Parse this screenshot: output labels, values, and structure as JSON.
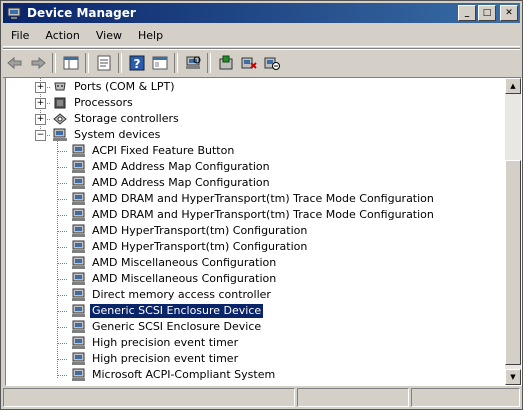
{
  "window": {
    "title": "Device Manager",
    "buttons": {
      "minimize": "_",
      "maximize": "□",
      "close": "✕"
    }
  },
  "menu": [
    "File",
    "Action",
    "View",
    "Help"
  ],
  "toolbar": {
    "icons": [
      "back-arrow-icon",
      "forward-arrow-icon",
      "show-hide-console-tree-icon",
      "properties-icon",
      "help-icon",
      "console-view-icon",
      "scan-hardware-icon",
      "update-driver-icon",
      "uninstall-icon",
      "disable-icon"
    ]
  },
  "tree": {
    "partial_top": "",
    "categories": [
      {
        "label": "Ports (COM & LPT)",
        "expanded": false
      },
      {
        "label": "Processors",
        "expanded": false
      },
      {
        "label": "Storage controllers",
        "expanded": false
      },
      {
        "label": "System devices",
        "expanded": true
      }
    ],
    "devices": [
      "ACPI Fixed Feature Button",
      "AMD Address Map Configuration",
      "AMD Address Map Configuration",
      "AMD DRAM and HyperTransport(tm) Trace Mode Configuration",
      "AMD DRAM and HyperTransport(tm) Trace Mode Configuration",
      "AMD HyperTransport(tm) Configuration",
      "AMD HyperTransport(tm) Configuration",
      "AMD Miscellaneous Configuration",
      "AMD Miscellaneous Configuration",
      "Direct memory access controller",
      "Generic SCSI Enclosure Device",
      "Generic SCSI Enclosure Device",
      "High precision event timer",
      "High precision event timer",
      "Microsoft ACPI-Compliant System"
    ],
    "selected_index": 10
  },
  "statusbar": {
    "panes": [
      "",
      "",
      ""
    ]
  }
}
